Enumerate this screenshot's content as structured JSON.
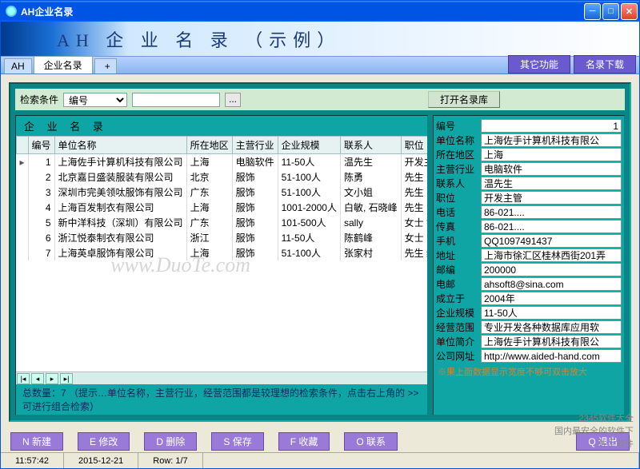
{
  "window": {
    "title": "AH企业名录"
  },
  "banner": {
    "title": "AH 企 业 名 录 （示例）"
  },
  "tabs": {
    "ah": "AH",
    "main": "企业名录",
    "plus": "+",
    "other": "其它功能",
    "download": "名录下载"
  },
  "search": {
    "label": "检索条件",
    "field": "编号",
    "value": "",
    "dots": "...",
    "open": "打开名录库"
  },
  "grid": {
    "title": "企 业 名 录",
    "headers": [
      "编号",
      "单位名称",
      "所在地区",
      "主营行业",
      "企业规模",
      "联系人",
      "职位"
    ],
    "rows": [
      {
        "id": "1",
        "name": "上海佐手计算机科技有限公司",
        "area": "上海",
        "ind": "电脑软件",
        "scale": "11-50人",
        "contact": "温先生",
        "pos": "开发主管"
      },
      {
        "id": "2",
        "name": "北京嘉日盛装服装有限公司",
        "area": "北京",
        "ind": "服饰",
        "scale": "51-100人",
        "contact": "陈勇",
        "pos": "先生"
      },
      {
        "id": "3",
        "name": "深圳市完美领呔服饰有限公司",
        "area": "广东",
        "ind": "服饰",
        "scale": "51-100人",
        "contact": "文小姐",
        "pos": "先生"
      },
      {
        "id": "4",
        "name": "上海百发制衣有限公司",
        "area": "上海",
        "ind": "服饰",
        "scale": "1001-2000人",
        "contact": "白敏, 石晓峰",
        "pos": "先生"
      },
      {
        "id": "5",
        "name": "新中洋科技（深圳）有限公司",
        "area": "广东",
        "ind": "服饰",
        "scale": "101-500人",
        "contact": "sally",
        "pos": "女士 销售经"
      },
      {
        "id": "6",
        "name": "浙江悦泰制衣有限公司",
        "area": "浙江",
        "ind": "服饰",
        "scale": "11-50人",
        "contact": "陈鹤峰",
        "pos": "女士"
      },
      {
        "id": "7",
        "name": "上海英卓服饰有限公司",
        "area": "上海",
        "ind": "服饰",
        "scale": "51-100人",
        "contact": "张家村",
        "pos": "先生 经理"
      }
    ],
    "footer": "总数量：7 （提示…单位名称，主营行业，经营范围都是较理想的检索条件，点击右上角的 >> 可进行组合检索）"
  },
  "detail": {
    "labels": {
      "id": "编号",
      "name": "单位名称",
      "area": "所在地区",
      "ind": "主营行业",
      "contact": "联系人",
      "pos": "职位",
      "tel": "电话",
      "fax": "传真",
      "mobile": "手机",
      "addr": "地址",
      "zip": "邮编",
      "email": "电邮",
      "founded": "成立于",
      "scale": "企业规模",
      "scope": "经营范围",
      "intro": "单位简介",
      "web": "公司网址"
    },
    "values": {
      "id": "1",
      "name": "上海佐手计算机科技有限公",
      "area": "上海",
      "ind": "电脑软件",
      "contact": "温先生",
      "pos": "开发主管",
      "tel": "86-021....",
      "fax": "86-021....",
      "mobile": "QQ1097491437",
      "addr": "上海市徐汇区桂林西街201弄",
      "zip": "200000",
      "email": "ahsoft8@sina.com",
      "founded": "2004年",
      "scale": "11-50人",
      "scope": "专业开发各种数据库应用软",
      "intro": "上海佐手计算机科技有限公",
      "web": "http://www.aided-hand.com"
    },
    "note": "※果上面数据显示宽度不够可双击放大"
  },
  "actions": {
    "new": "N 新建",
    "edit": "E 修改",
    "del": "D 删除",
    "save": "S 保存",
    "fav": "F 收藏",
    "link": "O 联系",
    "exit": "Q 退出"
  },
  "status": {
    "time": "11:57:42",
    "date": "2015-12-21",
    "row": "Row: 1/7"
  },
  "watermark": "www.DuoTe.com",
  "branding": {
    "line1": "2345软件大全",
    "line2": "国内最安全的软件下",
    "line3": "佐手软件"
  }
}
